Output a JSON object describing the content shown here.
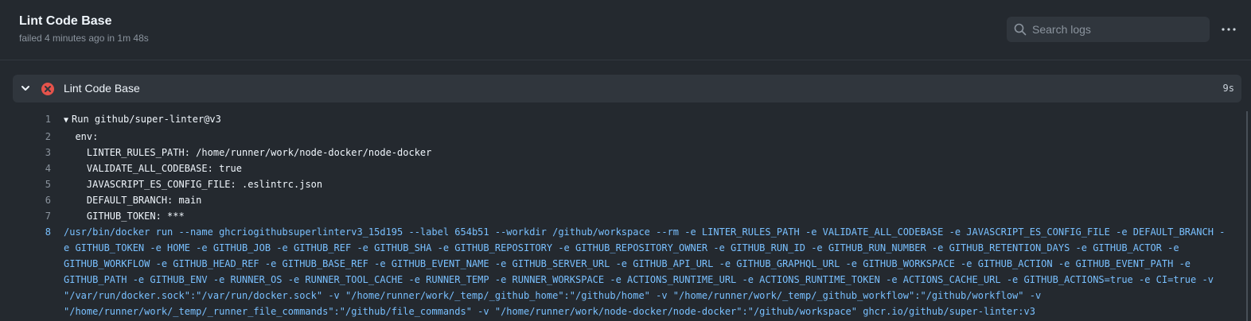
{
  "header": {
    "title": "Lint Code Base",
    "subtitle": "failed 4 minutes ago in 1m 48s",
    "search_placeholder": "Search logs"
  },
  "step": {
    "title": "Lint Code Base",
    "duration": "9s",
    "status": "failed",
    "status_color": "#e5534b"
  },
  "log": {
    "lines": [
      {
        "num": "1",
        "text": "Run github/super-linter@v3"
      },
      {
        "num": "2",
        "text": "  env:"
      },
      {
        "num": "3",
        "text": "    LINTER_RULES_PATH: /home/runner/work/node-docker/node-docker"
      },
      {
        "num": "4",
        "text": "    VALIDATE_ALL_CODEBASE: true"
      },
      {
        "num": "5",
        "text": "    JAVASCRIPT_ES_CONFIG_FILE: .eslintrc.json"
      },
      {
        "num": "6",
        "text": "    DEFAULT_BRANCH: main"
      },
      {
        "num": "7",
        "text": "    GITHUB_TOKEN: ***"
      },
      {
        "num": "8",
        "text": "/usr/bin/docker run --name ghcriogithubsuperlinterv3_15d195 --label 654b51 --workdir /github/workspace --rm -e LINTER_RULES_PATH -e VALIDATE_ALL_CODEBASE -e JAVASCRIPT_ES_CONFIG_FILE -e DEFAULT_BRANCH -e GITHUB_TOKEN -e HOME -e GITHUB_JOB -e GITHUB_REF -e GITHUB_SHA -e GITHUB_REPOSITORY -e GITHUB_REPOSITORY_OWNER -e GITHUB_RUN_ID -e GITHUB_RUN_NUMBER -e GITHUB_RETENTION_DAYS -e GITHUB_ACTOR -e GITHUB_WORKFLOW -e GITHUB_HEAD_REF -e GITHUB_BASE_REF -e GITHUB_EVENT_NAME -e GITHUB_SERVER_URL -e GITHUB_API_URL -e GITHUB_GRAPHQL_URL -e GITHUB_WORKSPACE -e GITHUB_ACTION -e GITHUB_EVENT_PATH -e GITHUB_PATH -e GITHUB_ENV -e RUNNER_OS -e RUNNER_TOOL_CACHE -e RUNNER_TEMP -e RUNNER_WORKSPACE -e ACTIONS_RUNTIME_URL -e ACTIONS_RUNTIME_TOKEN -e ACTIONS_CACHE_URL -e GITHUB_ACTIONS=true -e CI=true -v \"/var/run/docker.sock\":\"/var/run/docker.sock\" -v \"/home/runner/work/_temp/_github_home\":\"/github/home\" -v \"/home/runner/work/_temp/_github_workflow\":\"/github/workflow\" -v \"/home/runner/work/_temp/_runner_file_commands\":\"/github/file_commands\" -v \"/home/runner/work/node-docker/node-docker\":\"/github/workspace\" ghcr.io/github/super-linter:v3"
      }
    ]
  }
}
